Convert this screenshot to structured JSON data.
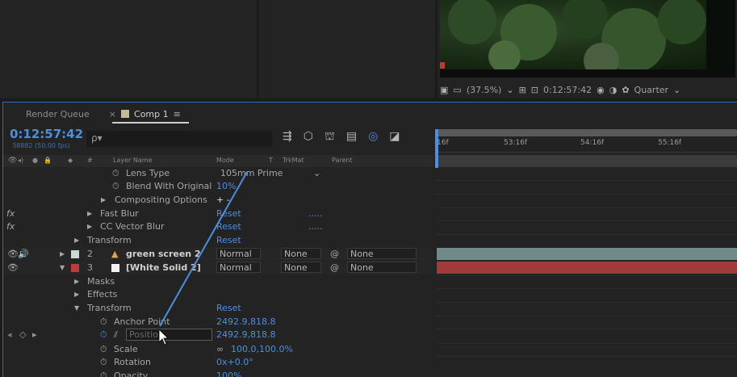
{
  "viewer": {
    "zoom": "(37.5%)",
    "timecode": "0:12:57:42",
    "resolution": "Quarter"
  },
  "tabs": {
    "render_queue": "Render Queue",
    "comp": "Comp 1",
    "close": "×",
    "menu": "≡"
  },
  "timeline": {
    "current_time": "0:12:57:42",
    "frame_info": "38882 (50.00 fps)",
    "search_placeholder": "ρ▾"
  },
  "columns": {
    "layer_name": "Layer Name",
    "mode": "Mode",
    "t": "T",
    "trkmat": "TrkMat",
    "parent": "Parent",
    "hash": "#"
  },
  "ruler": {
    "ticks": [
      ":16f",
      "53:16f",
      "54:16f",
      "55:16f"
    ]
  },
  "rows": {
    "lens_type": {
      "label": "Lens Type",
      "value": "105mm Prime"
    },
    "blend_with_original": {
      "label": "Blend With Original",
      "value": "10%"
    },
    "compositing_options": {
      "label": "Compositing Options",
      "value": "+ -"
    },
    "fast_blur": {
      "fx": "fx",
      "label": "Fast Blur",
      "value": "Reset",
      "dots": "....."
    },
    "cc_vector_blur": {
      "fx": "fx",
      "label": "CC Vector Blur",
      "value": "Reset",
      "dots": "....."
    },
    "transform1": {
      "label": "Transform",
      "value": "Reset"
    },
    "layer2": {
      "num": "2",
      "name": "green screen 2",
      "mode": "Normal",
      "trkmat": "None",
      "parent": "None"
    },
    "layer3": {
      "num": "3",
      "name": "[White Solid 2]",
      "mode": "Normal",
      "trkmat": "None",
      "parent": "None"
    },
    "masks": {
      "label": "Masks"
    },
    "effects": {
      "label": "Effects"
    },
    "transform2": {
      "label": "Transform",
      "value": "Reset"
    },
    "anchor_point": {
      "label": "Anchor Point",
      "value": "2492.9,818.8"
    },
    "position": {
      "label": "Position",
      "value": "2492.9,818.8"
    },
    "scale": {
      "label": "Scale",
      "value": "100.0,100.0%"
    },
    "rotation": {
      "label": "Rotation",
      "value": "0x+0.0°"
    },
    "opacity": {
      "label": "Opacity",
      "value": "100%"
    }
  },
  "colors": {
    "accent": "#4a8fe0",
    "layer2_label": "#c9d9d6",
    "layer3_label": "#c0393b",
    "green_bar": "#6f8a88",
    "red_bar": "#a13b3b"
  }
}
